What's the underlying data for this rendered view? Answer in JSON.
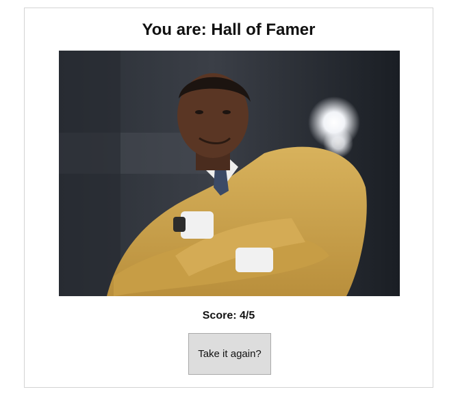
{
  "result": {
    "title": "You are: Hall of Famer",
    "image_subject": "man in gold hall-of-fame jacket with arms crossed",
    "score_text": "Score: 4/5",
    "retry_label": "Take it again?"
  },
  "colors": {
    "jacket": "#c9a24a",
    "background": "#1d2229",
    "button_bg": "#dddddd",
    "border": "#d3d3d3"
  }
}
